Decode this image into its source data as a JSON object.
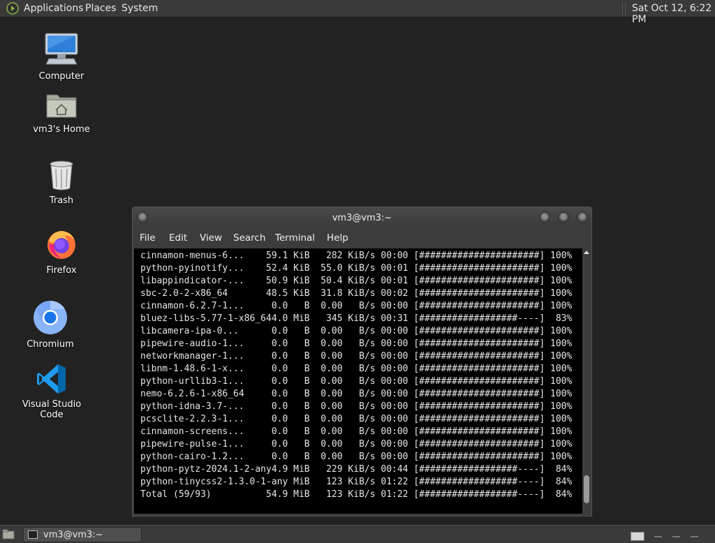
{
  "top_panel": {
    "menus": [
      "Applications",
      "Places",
      "System"
    ],
    "clock": "Sat Oct 12,  6:22 PM"
  },
  "desktop": {
    "icons": [
      {
        "label": "Computer",
        "icon": "computer-icon"
      },
      {
        "label": "vm3's Home",
        "icon": "home-folder-icon"
      },
      {
        "label": "Trash",
        "icon": "trash-icon"
      },
      {
        "label": "Firefox",
        "icon": "firefox-icon"
      },
      {
        "label": "Chromium",
        "icon": "chromium-icon"
      },
      {
        "label": "Visual Studio Code",
        "icon": "vscode-icon"
      }
    ]
  },
  "terminal": {
    "title": "vm3@vm3:~",
    "menu": [
      "File",
      "Edit",
      "View",
      "Search",
      "Terminal",
      "Help"
    ],
    "lines": [
      "cinnamon-menus-6...    59.1 KiB   282 KiB/s 00:00 [######################] 100%",
      "python-pyinotify...    52.4 KiB  55.0 KiB/s 00:01 [######################] 100%",
      "libappindicator-...    50.9 KiB  50.4 KiB/s 00:01 [######################] 100%",
      "sbc-2.0-2-x86_64       48.5 KiB  31.8 KiB/s 00:02 [######################] 100%",
      "cinnamon-6.2.7-1...     0.0   B  0.00   B/s 00:00 [######################] 100%",
      "bluez-libs-5.77-1-x86_644.0 MiB   345 KiB/s 00:31 [##################----]  83%",
      "libcamera-ipa-0...      0.0   B  0.00   B/s 00:00 [######################] 100%",
      "pipewire-audio-1...     0.0   B  0.00   B/s 00:00 [######################] 100%",
      "networkmanager-1...     0.0   B  0.00   B/s 00:00 [######################] 100%",
      "libnm-1.48.6-1-x...     0.0   B  0.00   B/s 00:00 [######################] 100%",
      "python-urllib3-1...     0.0   B  0.00   B/s 00:00 [######################] 100%",
      "nemo-6.2.6-1-x86_64     0.0   B  0.00   B/s 00:00 [######################] 100%",
      "python-idna-3.7-...     0.0   B  0.00   B/s 00:00 [######################] 100%",
      "pcsclite-2.2.3-1...     0.0   B  0.00   B/s 00:00 [######################] 100%",
      "cinnamon-screens...     0.0   B  0.00   B/s 00:00 [######################] 100%",
      "pipewire-pulse-1...     0.0   B  0.00   B/s 00:00 [######################] 100%",
      "python-cairo-1.2...     0.0   B  0.00   B/s 00:00 [######################] 100%",
      "python-pytz-2024.1-2-any4.9 MiB   229 KiB/s 00:44 [##################----]  84%",
      "python-tinycss2-1.3.0-1-any MiB   123 KiB/s 01:22 [##################----]  84%",
      "Total (59/93)          54.9 MiB   123 KiB/s 01:22 [##################----]  84%"
    ]
  },
  "taskbar": {
    "task_label": "vm3@vm3:~"
  }
}
